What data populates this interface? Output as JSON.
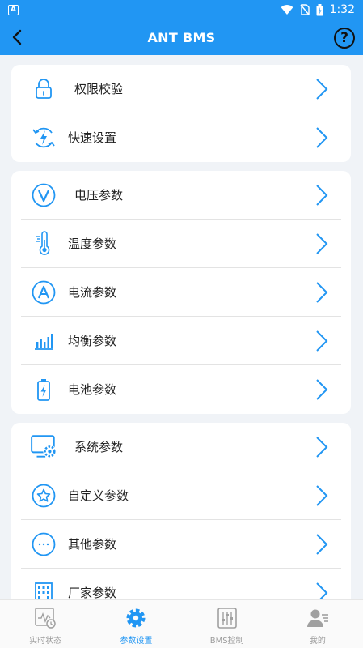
{
  "status_bar": {
    "time": "1:32",
    "app_icon_letter": "A"
  },
  "header": {
    "title": "ANT BMS",
    "back_icon": "back-arrow-icon",
    "help_label": "?"
  },
  "sections": [
    {
      "items": [
        {
          "label": "权限校验",
          "icon": "lock-icon"
        },
        {
          "label": "快速设置",
          "icon": "quick-settings-icon"
        }
      ]
    },
    {
      "items": [
        {
          "label": "电压参数",
          "icon": "voltage-icon"
        },
        {
          "label": "温度参数",
          "icon": "thermometer-icon"
        },
        {
          "label": "电流参数",
          "icon": "current-icon"
        },
        {
          "label": "均衡参数",
          "icon": "balance-icon"
        },
        {
          "label": "电池参数",
          "icon": "battery-icon"
        }
      ]
    },
    {
      "items": [
        {
          "label": "系统参数",
          "icon": "system-icon"
        },
        {
          "label": "自定义参数",
          "icon": "custom-star-icon"
        },
        {
          "label": "其他参数",
          "icon": "more-icon"
        },
        {
          "label": "厂家参数",
          "icon": "factory-icon"
        }
      ]
    }
  ],
  "tabbar": {
    "tabs": [
      {
        "label": "实时状态",
        "icon": "realtime-status-icon",
        "active": false
      },
      {
        "label": "参数设置",
        "icon": "settings-gear-icon",
        "active": true
      },
      {
        "label": "BMS控制",
        "icon": "bms-control-icon",
        "active": false
      },
      {
        "label": "我的",
        "icon": "profile-icon",
        "active": false
      }
    ]
  },
  "colors": {
    "primary": "#2196f3",
    "background": "#f0f3f7",
    "card": "#ffffff",
    "inactive": "#9a9a9a"
  }
}
